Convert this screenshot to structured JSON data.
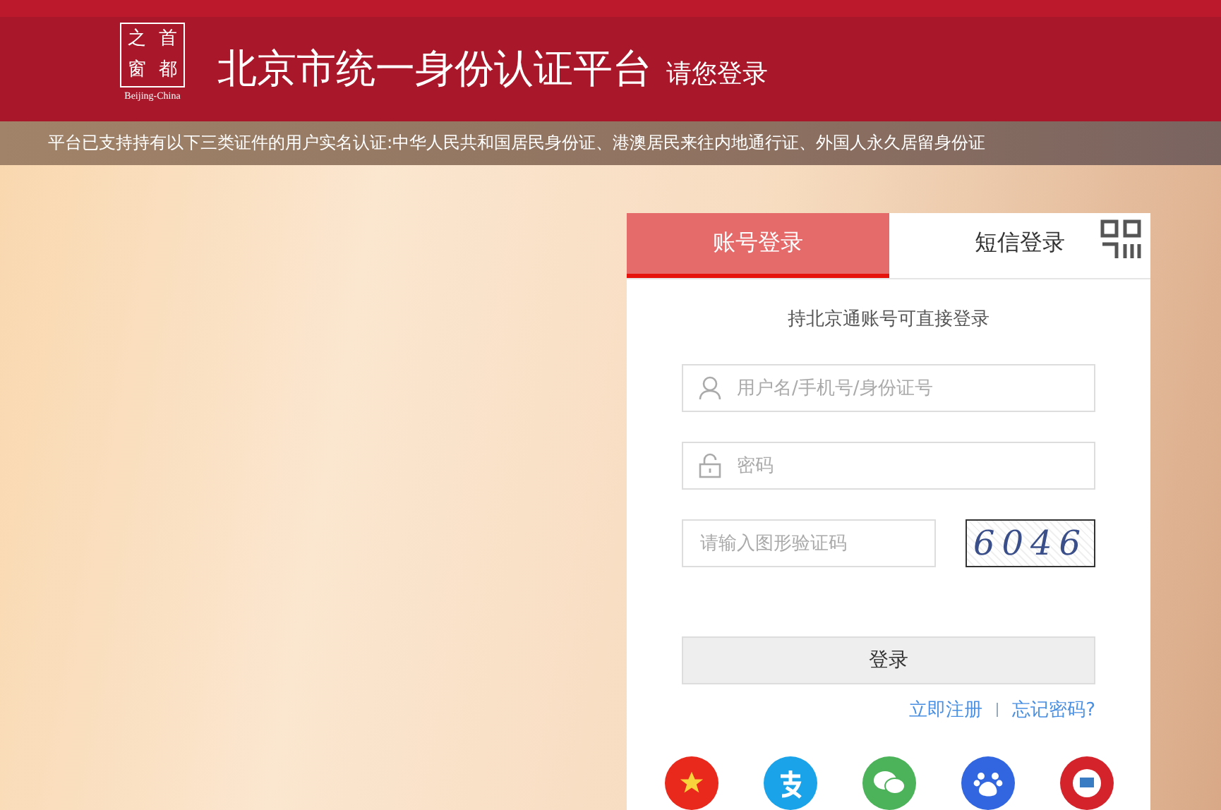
{
  "header": {
    "logo": {
      "chars": [
        "之",
        "首",
        "窗",
        "都"
      ],
      "caption": "Beijing-China"
    },
    "title": "北京市统一身份认证平台",
    "subtitle": "请您登录"
  },
  "notice": "平台已支持持有以下三类证件的用户实名认证:中华人民共和国居民身份证、港澳居民来往内地通行证、外国人永久居留身份证",
  "login": {
    "tabs": [
      {
        "label": "账号登录",
        "selected": true
      },
      {
        "label": "短信登录",
        "selected": false
      }
    ],
    "hint": "持北京通账号可直接登录",
    "fields": [
      {
        "kind": "user",
        "placeholder": "用户名/手机号/身份证号"
      },
      {
        "kind": "password",
        "placeholder": "密码"
      },
      {
        "kind": "captcha",
        "placeholder": "请输入图形验证码",
        "captcha": "6046"
      }
    ],
    "submit": "登录",
    "links": [
      "立即注册",
      "忘记密码?"
    ],
    "third_party": [
      {
        "kind": "emblem",
        "color": "#e8291c"
      },
      {
        "kind": "alipay",
        "color": "#1aa3e8"
      },
      {
        "kind": "wechat",
        "color": "#4cb35a"
      },
      {
        "kind": "baidu",
        "color": "#3266e0"
      },
      {
        "kind": "badge",
        "color": "#d4232b"
      }
    ]
  }
}
